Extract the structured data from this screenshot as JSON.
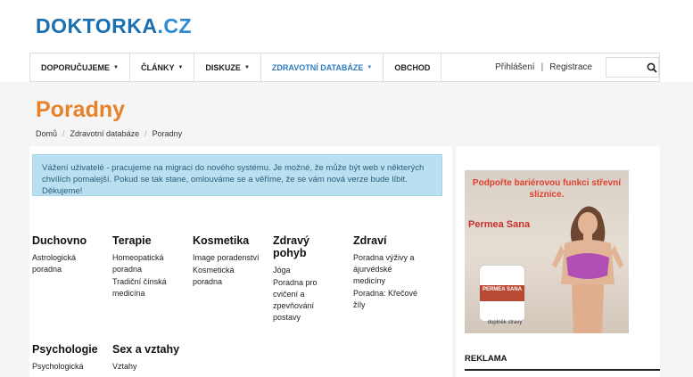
{
  "logo": {
    "main": "DOKTORKA",
    "tld": ".CZ"
  },
  "nav": {
    "items": [
      {
        "label": "DOPORUČUJEME",
        "caret": true,
        "active": false
      },
      {
        "label": "ČLÁNKY",
        "caret": true,
        "active": false
      },
      {
        "label": "DISKUZE",
        "caret": true,
        "active": false
      },
      {
        "label": "ZDRAVOTNÍ DATABÁZE",
        "caret": true,
        "active": true
      },
      {
        "label": "OBCHOD",
        "caret": false,
        "active": false
      }
    ],
    "login": "Přihlášení",
    "separator": "|",
    "register": "Registrace",
    "search_placeholder": ""
  },
  "page": {
    "title": "Poradny",
    "breadcrumb": [
      "Domů",
      "Zdravotní databáze",
      "Poradny"
    ],
    "breadcrumb_sep": "/"
  },
  "alert": {
    "text": "Vážení uživatelé - pracujeme na migraci do nového systému. Je možné, že může být web v některých chvílích pomalejší. Pokud se tak stane, omlouváme se a věříme, že se vám nová verze bude líbit. Děkujeme!"
  },
  "categories": [
    {
      "title": "Duchovno",
      "links": [
        "Astrologická poradna"
      ]
    },
    {
      "title": "Terapie",
      "links": [
        "Homeopatická poradna",
        "Tradiční čínská medicína"
      ]
    },
    {
      "title": "Kosmetika",
      "links": [
        "Image poradenství",
        "Kosmetická poradna"
      ]
    },
    {
      "title": "Zdravý pohyb",
      "links": [
        "Jóga",
        "Poradna pro cvičení a zpevňování postavy"
      ]
    },
    {
      "title": "Zdraví",
      "links": [
        "Poradna výživy a ájurvédské medicíny",
        "Poradna: Křečové žíly"
      ]
    },
    {
      "title": "Psychologie",
      "links": [
        "Psychologická"
      ]
    },
    {
      "title": "Sex a vztahy",
      "links": [
        "Vztahy"
      ]
    }
  ],
  "ad": {
    "headline": "Podpořte bariérovou funkci střevní sliznice.",
    "brand": "Permea Sana",
    "jar_label": "PERMEA SANA",
    "footnote": "doplněk stravy"
  },
  "sidebar": {
    "title": "REKLAMA"
  },
  "colors": {
    "accent": "#e8822a",
    "brand": "#1a6fb0",
    "link_active": "#2c7cc0",
    "alert_bg": "#b9dff0"
  }
}
